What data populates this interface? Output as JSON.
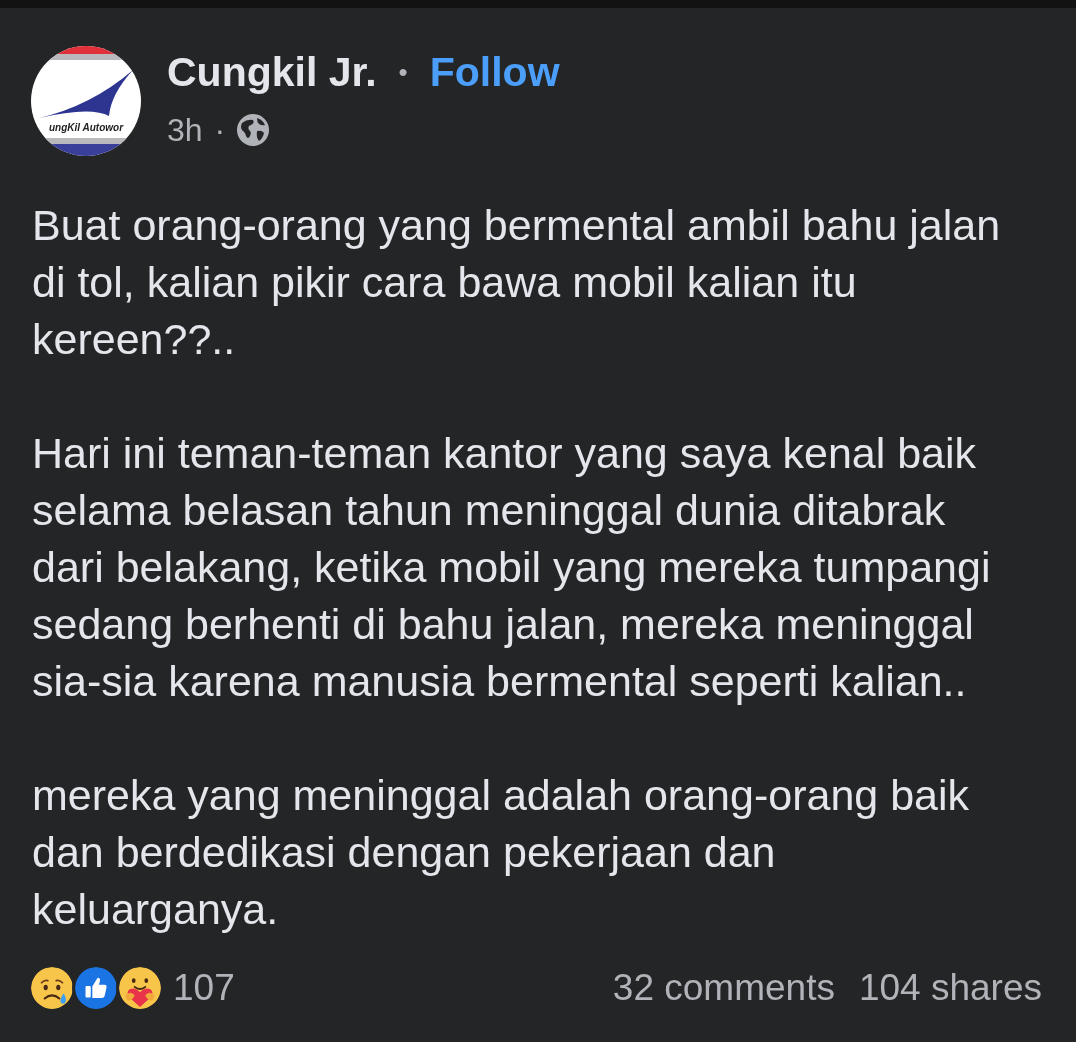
{
  "post": {
    "author": {
      "name": "Cungkil Jr.",
      "avatar_logo_text": "ungKil Autowor",
      "name_separator": "•",
      "follow": "Follow"
    },
    "meta": {
      "time": "3h",
      "separator": "·"
    },
    "paragraphs": [
      "Buat orang-orang yang bermental ambil bahu jalan di tol, kalian pikir cara bawa mobil kalian itu kereen??..",
      "Hari ini teman-teman kantor yang saya kenal baik selama belasan tahun meninggal dunia ditabrak dari belakang, ketika mobil yang mereka tumpangi sedang berhenti di bahu jalan, mereka meninggal sia-sia karena manusia bermental seperti kalian..",
      "mereka yang meninggal adalah orang-orang baik dan berdedikasi dengan pekerjaan dan keluarganya."
    ],
    "reactions": {
      "icons": [
        {
          "kind": "sad"
        },
        {
          "kind": "like"
        },
        {
          "kind": "care"
        }
      ],
      "count": "107"
    },
    "comments": "32 comments",
    "shares": "104 shares"
  }
}
